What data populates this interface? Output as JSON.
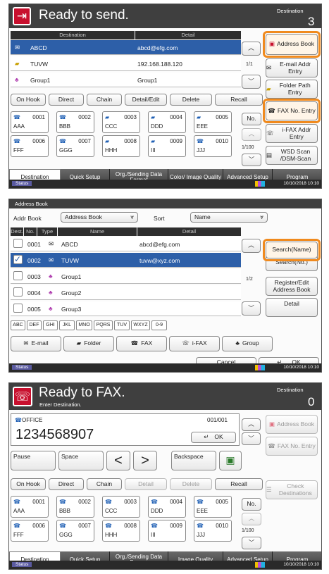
{
  "p1": {
    "title": "Ready to send.",
    "dest_label": "Destination",
    "dest_count": "3",
    "col_destination": "Destination",
    "col_detail": "Detail",
    "rows": [
      {
        "name": "ABCD",
        "detail": "abcd@efg.com"
      },
      {
        "name": "TUVW",
        "detail": "192.168.188.120"
      },
      {
        "name": "Group1",
        "detail": "Group1"
      }
    ],
    "page": "1/1",
    "right": [
      "Address Book",
      "E-mail Addr Entry",
      "Folder Path Entry",
      "FAX No. Entry",
      "i-FAX Addr Entry",
      "WSD Scan /DSM-Scan"
    ],
    "actions": [
      "On Hook",
      "Direct",
      "Chain",
      "Detail/Edit",
      "Delete",
      "Recall"
    ],
    "speed": [
      {
        "n": "0001",
        "l": "AAA"
      },
      {
        "n": "0002",
        "l": "BBB"
      },
      {
        "n": "0003",
        "l": "CCC"
      },
      {
        "n": "0004",
        "l": "DDD"
      },
      {
        "n": "0005",
        "l": "EEE"
      },
      {
        "n": "0006",
        "l": "FFF"
      },
      {
        "n": "0007",
        "l": "GGG"
      },
      {
        "n": "0008",
        "l": "HHH"
      },
      {
        "n": "0009",
        "l": "III"
      },
      {
        "n": "0010",
        "l": "JJJ"
      }
    ],
    "no": "No.",
    "speed_page": "1/100",
    "tabs": [
      "Destination",
      "Quick Setup",
      "Org./Sending Data Format",
      "Color/ Image Quality",
      "Advanced Setup",
      "Program"
    ],
    "status": "Status",
    "datetime": "10/10/2018 10:10"
  },
  "p2": {
    "title": "Address Book",
    "addr_book_label": "Addr Book",
    "addr_book_value": "Address Book",
    "sort_label": "Sort",
    "sort_value": "Name",
    "col_dest": "Dest.",
    "col_no": "No.",
    "col_type": "Type",
    "col_name": "Name",
    "col_detail": "Detail",
    "rows": [
      {
        "no": "0001",
        "name": "ABCD",
        "detail": "abcd@efg.com"
      },
      {
        "no": "0002",
        "name": "TUVW",
        "detail": "tuvw@xyz.com"
      },
      {
        "no": "0003",
        "name": "Group1",
        "detail": ""
      },
      {
        "no": "0004",
        "name": "Group2",
        "detail": ""
      },
      {
        "no": "0005",
        "name": "Group3",
        "detail": ""
      }
    ],
    "page": "1/2",
    "search_name": "Search(Name)",
    "search_no": "Search(No.)",
    "register": "Register/Edit Address Book",
    "detail": "Detail",
    "keys": [
      "ABC",
      "DEF",
      "GHI",
      "JKL",
      "MNO",
      "PQRS",
      "TUV",
      "WXYZ",
      "0-9"
    ],
    "filters": [
      "E-mail",
      "Folder",
      "FAX",
      "i-FAX",
      "Group"
    ],
    "cancel": "Cancel",
    "ok": "OK",
    "status": "Status",
    "datetime": "10/10/2018 10:10"
  },
  "p3": {
    "title": "Ready to FAX.",
    "subtitle": "Enter Destination.",
    "dest_label": "Destination",
    "dest_count": "0",
    "fax_name": "OFFICE",
    "fax_count": "001/001",
    "number": "1234568907",
    "ok": "OK",
    "keys": [
      "Pause",
      "Space",
      "Backspace"
    ],
    "right": [
      "Address Book",
      "FAX No. Entry",
      "Check Destinations"
    ],
    "actions": [
      "On Hook",
      "Direct",
      "Chain",
      "Detail",
      "Delete",
      "Recall"
    ],
    "speed": [
      {
        "n": "0001",
        "l": "AAA"
      },
      {
        "n": "0002",
        "l": "BBB"
      },
      {
        "n": "0003",
        "l": "CCC"
      },
      {
        "n": "0004",
        "l": "DDD"
      },
      {
        "n": "0005",
        "l": "EEE"
      },
      {
        "n": "0006",
        "l": "FFF"
      },
      {
        "n": "0007",
        "l": "GGG"
      },
      {
        "n": "0008",
        "l": "HHH"
      },
      {
        "n": "0009",
        "l": "III"
      },
      {
        "n": "0010",
        "l": "JJJ"
      }
    ],
    "no": "No.",
    "speed_page": "1/100",
    "tabs": [
      "Destination",
      "Quick Setup",
      "Org./Sending Data Format",
      "Image Quality",
      "Advanced Setup",
      "Program"
    ],
    "status": "Status",
    "datetime": "10/10/2018 10:10"
  }
}
